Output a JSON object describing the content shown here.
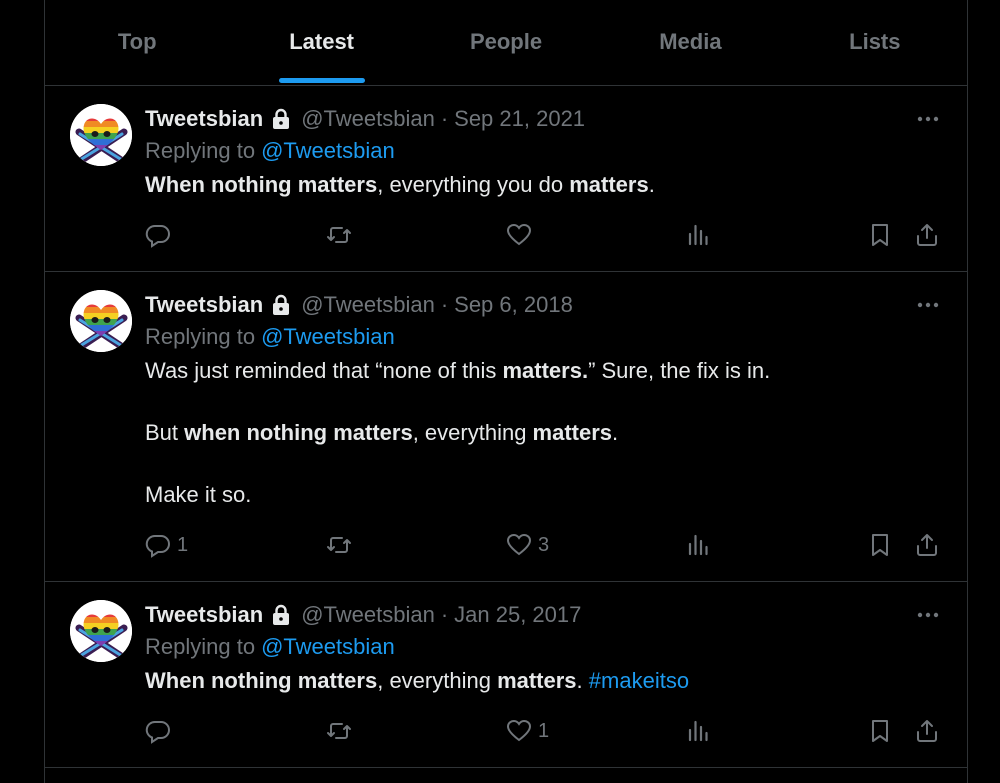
{
  "tabs": [
    {
      "label": "Top",
      "active": false
    },
    {
      "label": "Latest",
      "active": true
    },
    {
      "label": "People",
      "active": false
    },
    {
      "label": "Media",
      "active": false
    },
    {
      "label": "Lists",
      "active": false
    }
  ],
  "colors": {
    "accent": "#1d9bf0",
    "text": "#e7e9ea",
    "muted": "#71767b",
    "border": "#2f3336",
    "background": "#000000"
  },
  "tweets": [
    {
      "name": "Tweetsbian",
      "handle": "@Tweetsbian",
      "separator": "·",
      "date": "Sep 21, 2021",
      "replying_label": "Replying to",
      "replying_to": "@Tweetsbian",
      "body": {
        "l1a": "When nothing matters",
        "l1b": ", everything you do ",
        "l1c": "matters",
        "l1d": "."
      },
      "replies": "",
      "likes": ""
    },
    {
      "name": "Tweetsbian",
      "handle": "@Tweetsbian",
      "separator": "·",
      "date": "Sep 6, 2018",
      "replying_label": "Replying to",
      "replying_to": "@Tweetsbian",
      "body": {
        "p1a": "Was just reminded that “none of this ",
        "p1b": "matters.",
        "p1c": "” Sure, the fix is in.",
        "p2a": "But ",
        "p2b": "when nothing matters",
        "p2c": ", everything ",
        "p2d": "matters",
        "p2e": ".",
        "p3": "Make it so."
      },
      "replies": "1",
      "likes": "3"
    },
    {
      "name": "Tweetsbian",
      "handle": "@Tweetsbian",
      "separator": "·",
      "date": "Jan 25, 2017",
      "replying_label": "Replying to",
      "replying_to": "@Tweetsbian",
      "body": {
        "l1a": "When nothing matters",
        "l1b": ", everything ",
        "l1c": "matters",
        "l1d": ". ",
        "hashtag": "#makeitso"
      },
      "replies": "",
      "likes": "1"
    }
  ],
  "icons": {
    "avatar": "rainbow-heart-skull-crossbones-avatar",
    "lock": "lock-icon",
    "more": "more-dots-icon",
    "reply": "reply-bubble-icon",
    "retweet": "retweet-icon",
    "like": "heart-icon",
    "views": "views-bars-icon",
    "bookmark": "bookmark-icon",
    "share": "share-icon"
  }
}
